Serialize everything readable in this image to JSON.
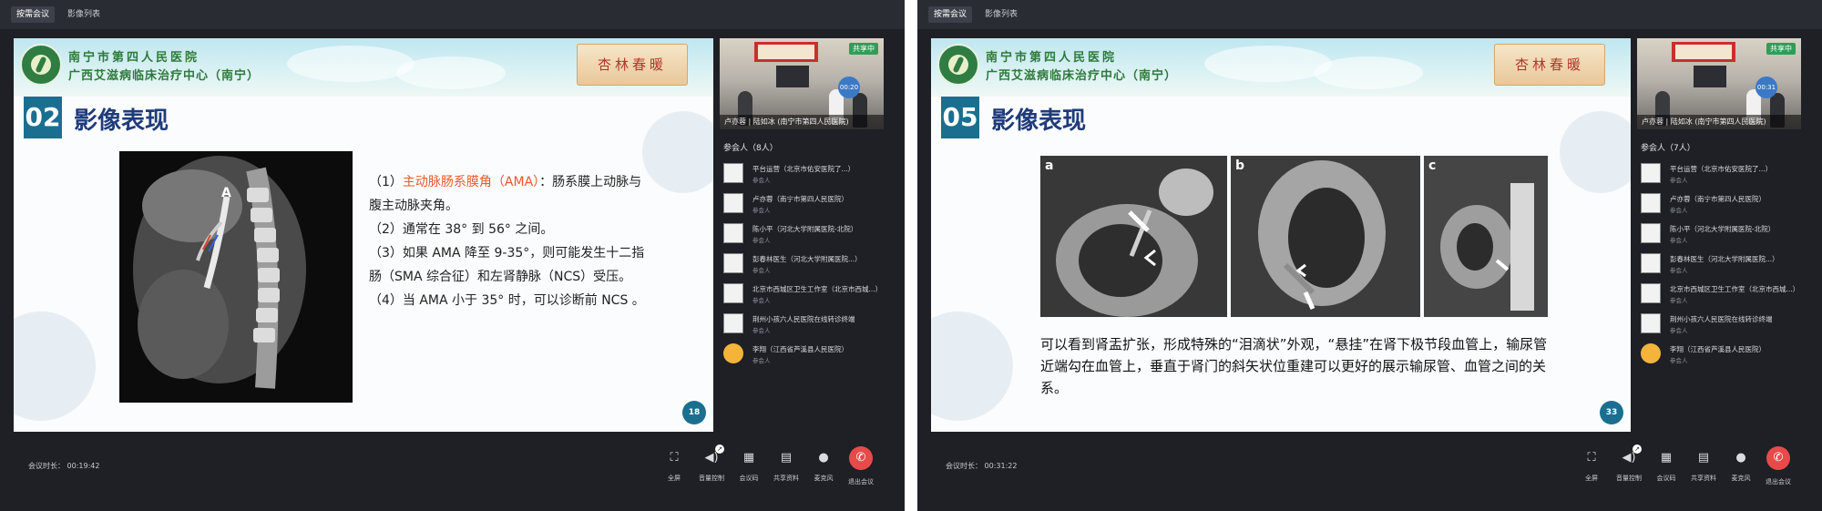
{
  "panels": [
    {
      "tabs": [
        "按需会议",
        "影像列表"
      ],
      "slide": {
        "hospital_line1": "南宁市第四人民医院",
        "hospital_line2": "广西艾滋病临床治疗中心（南宁）",
        "calligraphy": "杏林春暖",
        "number": "02",
        "title": "影像表现",
        "page": "18",
        "image_label": "A",
        "paragraphs": [
          {
            "prefix": "（1）",
            "highlight": "主动脉肠系膜角（AMA）",
            "text": "：肠系膜上动脉与腹主动脉夹角。"
          },
          {
            "prefix": "",
            "highlight": "",
            "text": "（2）通常在 38° 到 56° 之间。"
          },
          {
            "prefix": "",
            "highlight": "",
            "text": "（3）如果 AMA 降至 9-35°，则可能发生十二指肠（SMA 综合征）和左肾静脉（NCS）受压。"
          },
          {
            "prefix": "",
            "highlight": "",
            "text": "（4）当 AMA 小于 35° 时，可以诊断前 NCS 。"
          }
        ]
      },
      "video": {
        "share_tag": "共享中",
        "time": "00:20",
        "caption": "卢亦蓉 | 陆如冰 (南宁市第四人民医院)"
      },
      "participants_title": "参会人（8人）",
      "participants": [
        {
          "name": "平台运营（北京市佑安医院了...）",
          "role": "参会人"
        },
        {
          "name": "卢亦蓉（南宁市第四人民医院）",
          "role": "参会人"
        },
        {
          "name": "陈小平（河北大学附属医院-北院）",
          "role": "参会人"
        },
        {
          "name": "彭春林医生（河北大学附属医院...）",
          "role": "参会人"
        },
        {
          "name": "北京市西城区卫生工作室（北京市西城...）",
          "role": "参会人"
        },
        {
          "name": "荆州小孩六人民医院在线转诊终端",
          "role": "参会人"
        },
        {
          "name": "李翔（江西省芦溪县人民医院）",
          "role": "参会人"
        }
      ],
      "duration": "会议时长：  00:19:42"
    },
    {
      "tabs": [
        "按需会议",
        "影像列表"
      ],
      "slide": {
        "hospital_line1": "南宁市第四人民医院",
        "hospital_line2": "广西艾滋病临床治疗中心（南宁）",
        "calligraphy": "杏林春暖",
        "number": "05",
        "title": "影像表现",
        "page": "33",
        "image_labels": [
          "a",
          "b",
          "c"
        ],
        "description": "可以看到肾盂扩张，形成特殊的“泪滴状”外观，“悬挂”在肾下极节段血管上，输尿管近端勾在血管上，垂直于肾门的斜矢状位重建可以更好的展示输尿管、血管之间的关系。"
      },
      "video": {
        "share_tag": "共享中",
        "time": "00:31",
        "caption": "卢亦蓉 | 陆如冰 (南宁市第四人民医院)"
      },
      "participants_title": "参会人（7人）",
      "participants": [
        {
          "name": "平台运营（北京市佑安医院了...）",
          "role": "参会人"
        },
        {
          "name": "卢亦蓉（南宁市第四人民医院）",
          "role": "参会人"
        },
        {
          "name": "陈小平（河北大学附属医院-北院）",
          "role": "参会人"
        },
        {
          "name": "彭春林医生（河北大学附属医院...）",
          "role": "参会人"
        },
        {
          "name": "北京市西城区卫生工作室（北京市西城...）",
          "role": "参会人"
        },
        {
          "name": "荆州小孩六人民医院在线转诊终端",
          "role": "参会人"
        },
        {
          "name": "李翔（江西省芦溪县人民医院）",
          "role": "参会人"
        }
      ],
      "duration": "会议时长：  00:31:22"
    }
  ],
  "controls": [
    {
      "label": "全屏",
      "icon": "fullscreen-icon"
    },
    {
      "label": "音量控制",
      "icon": "speaker-icon"
    },
    {
      "label": "会议码",
      "icon": "qrcode-icon"
    },
    {
      "label": "共享资料",
      "icon": "document-icon"
    },
    {
      "label": "麦克风",
      "icon": "microphone-icon"
    },
    {
      "label": "退出会议",
      "icon": "hangup-icon"
    }
  ],
  "colors": {
    "accent": "#1a6f91",
    "highlight": "#e55a2b",
    "hangup": "#e84a4a",
    "share_green": "#2e9e57"
  }
}
